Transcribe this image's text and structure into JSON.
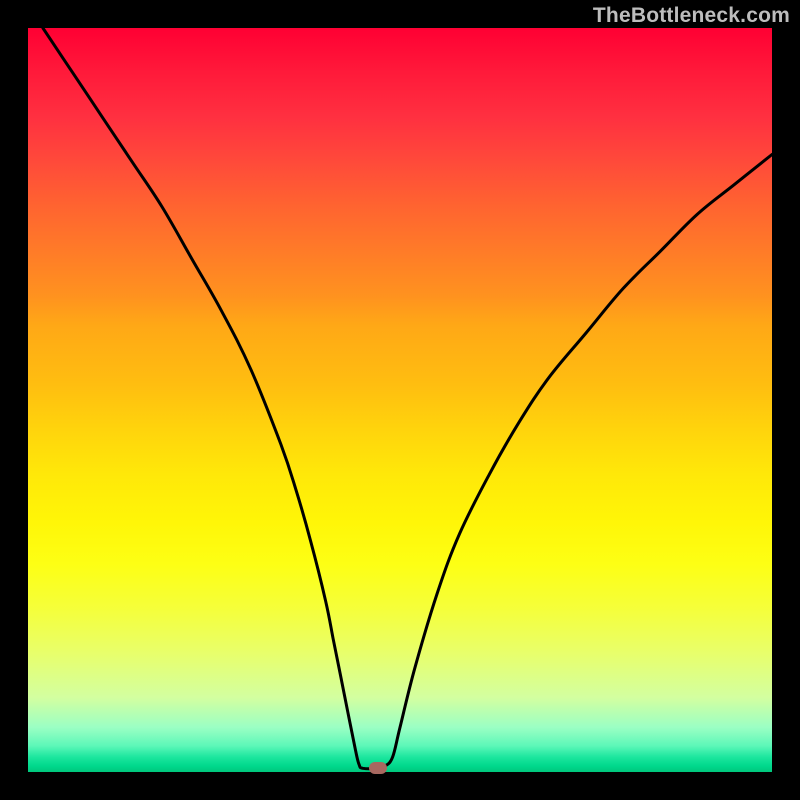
{
  "watermark": "TheBottleneck.com",
  "chart_data": {
    "type": "line",
    "title": "",
    "xlabel": "",
    "ylabel": "",
    "xlim": [
      0,
      100
    ],
    "ylim": [
      0,
      100
    ],
    "series": [
      {
        "name": "curve",
        "x": [
          2,
          6,
          10,
          14,
          18,
          22,
          26,
          30,
          34,
          36,
          38,
          40,
          41,
          42,
          43,
          44,
          44.5,
          45,
          47,
          48,
          49,
          50,
          52,
          55,
          58,
          62,
          66,
          70,
          75,
          80,
          85,
          90,
          95,
          100
        ],
        "y": [
          100,
          94,
          88,
          82,
          76,
          69,
          62,
          54,
          44,
          38,
          31,
          23,
          18,
          13,
          8,
          3,
          1,
          0.5,
          0.5,
          0.8,
          2,
          6,
          14,
          24,
          32,
          40,
          47,
          53,
          59,
          65,
          70,
          75,
          79,
          83
        ]
      }
    ],
    "marker": {
      "x": 47,
      "y": 0.6
    },
    "background_gradient": {
      "orientation": "vertical",
      "stops": [
        {
          "pos": 0,
          "color": "#ff0033"
        },
        {
          "pos": 25,
          "color": "#ff6a2e"
        },
        {
          "pos": 50,
          "color": "#ffcf0d"
        },
        {
          "pos": 75,
          "color": "#f6ff30"
        },
        {
          "pos": 95,
          "color": "#7bf9bd"
        },
        {
          "pos": 100,
          "color": "#00c77c"
        }
      ]
    }
  }
}
